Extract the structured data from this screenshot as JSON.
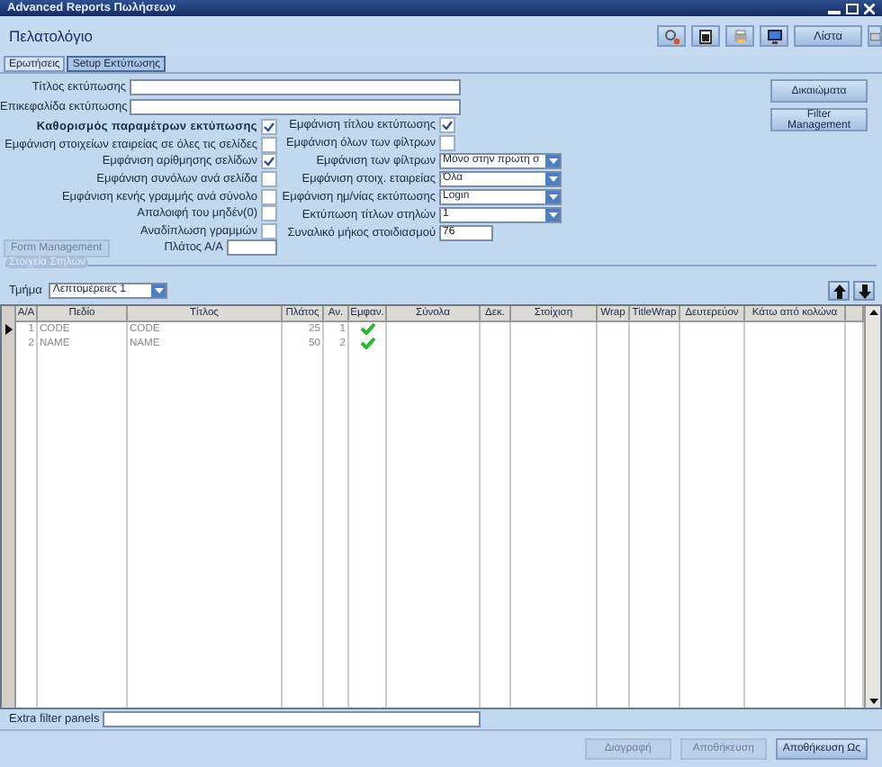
{
  "window": {
    "title": "Advanced Reports Πωλήσεων"
  },
  "header": {
    "title": "Πελατολόγιο",
    "list_button": "Λίστα"
  },
  "tabs": [
    {
      "label": "Ερωτήσεις",
      "selected": false
    },
    {
      "label": "Setup Εκτύπωσης",
      "selected": true
    }
  ],
  "text_fields": [
    {
      "label": "Τίτλος εκτύπωσης"
    },
    {
      "label": "Επικεφαλίδα εκτύπωσης"
    }
  ],
  "left_options": [
    {
      "label": "Καθορισμός παραμέτρων εκτύπωσης",
      "bold": true,
      "checked": true
    },
    {
      "label": "Εμφάνιση στοιχείων εταιρείας σε όλες τις σελίδες",
      "bold": false,
      "checked": false
    },
    {
      "label": "Εμφάνιση αρίθμησης σελίδων",
      "bold": false,
      "checked": true
    },
    {
      "label": "Εμφάνιση συνόλων ανά σελίδα",
      "bold": false,
      "checked": false
    },
    {
      "label": "Εμφάνιση κενής γραμμής ανά σύνολο",
      "bold": false,
      "checked": false
    },
    {
      "label": "Απαλοιφή του μηδέν(0)",
      "bold": false,
      "checked": false
    },
    {
      "label": "Αναδίπλωση γραμμών",
      "bold": false,
      "checked": false
    }
  ],
  "form_management": {
    "label": "Form Management",
    "disabled": true
  },
  "aa_width": {
    "label": "Πλάτος Α/Α"
  },
  "right_options": [
    {
      "kind": "checkbox",
      "label": "Εμφάνιση τίτλου εκτύπωσης",
      "checked": true
    },
    {
      "kind": "checkbox",
      "label": "Εμφάνιση όλων των φίλτρων",
      "checked": false
    },
    {
      "kind": "combo",
      "label": "Εμφάνιση των φίλτρων",
      "value": "Μόνο στην πρώτη σ"
    },
    {
      "kind": "combo",
      "label": "Εμφάνιση στοιχ. εταιρείας",
      "value": "Όλα"
    },
    {
      "kind": "combo",
      "label": "Εμφάνιση ημ/νίας εκτύπωσης",
      "value": "Login"
    },
    {
      "kind": "combo",
      "label": "Εκτύπωση τίτλων στηλών",
      "value": "1"
    },
    {
      "kind": "field",
      "label": "Συναλικό μήκος στοιδιασμού",
      "value": "76"
    }
  ],
  "side_buttons": [
    "Δικαιώματα",
    "Filter Management"
  ],
  "group": {
    "title": "Στοιχεία Στηλών",
    "section_label": "Τμήμα",
    "section_value": "Λεπτομέρειες 1"
  },
  "table": {
    "columns": [
      "Α/Α",
      "Πεδίο",
      "Τίτλος",
      "Πλάτος",
      "Αν.",
      "Εμφαν.",
      "Σύνολα",
      "Δεκ.",
      "Στοίχιση",
      "Wrap",
      "TitleWrap",
      "Δευτερεύον",
      "Κάτω από κολώνα"
    ],
    "rows": [
      {
        "current": true,
        "cells": [
          "1",
          "CODE",
          "CODE",
          "25",
          "1"
        ],
        "visible": true
      },
      {
        "current": false,
        "cells": [
          "2",
          "NAME",
          "NAME",
          "50",
          "2"
        ],
        "visible": true
      }
    ]
  },
  "extra_filter": {
    "label": "Extra filter panels"
  },
  "bottom_buttons": [
    {
      "label": "Διαγραφή",
      "disabled": true
    },
    {
      "label": "Αποθήκευση",
      "disabled": true
    },
    {
      "label": "Αποθήκευση Ως",
      "disabled": false
    }
  ]
}
